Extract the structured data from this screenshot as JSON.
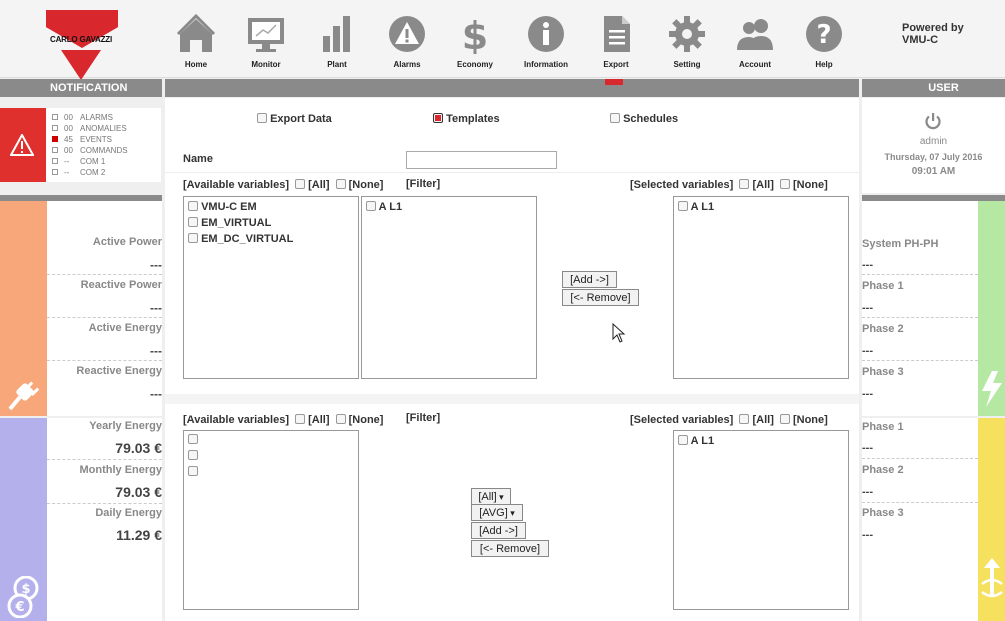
{
  "header": {
    "brand": "CARLO GAVAZZI",
    "nav": [
      {
        "label": "Home",
        "icon": "home-icon"
      },
      {
        "label": "Monitor",
        "icon": "monitor-icon"
      },
      {
        "label": "Plant",
        "icon": "plant-icon"
      },
      {
        "label": "Alarms",
        "icon": "alarms-icon"
      },
      {
        "label": "Economy",
        "icon": "economy-icon"
      },
      {
        "label": "Information",
        "icon": "information-icon"
      },
      {
        "label": "Export",
        "icon": "export-icon"
      },
      {
        "label": "Setting",
        "icon": "setting-icon"
      },
      {
        "label": "Account",
        "icon": "account-icon"
      },
      {
        "label": "Help",
        "icon": "help-icon"
      }
    ],
    "powered_line1": "Powered by",
    "powered_line2": "VMU-C"
  },
  "sections": {
    "notification": "NOTIFICATION",
    "user": "USER"
  },
  "notifications": [
    {
      "count": "00",
      "label": "ALARMS",
      "active": false
    },
    {
      "count": "00",
      "label": "ANOMALIES",
      "active": false
    },
    {
      "count": "45",
      "label": "EVENTS",
      "active": true
    },
    {
      "count": "00",
      "label": "COMMANDS",
      "active": false
    },
    {
      "count": "--",
      "label": "COM 1",
      "active": false
    },
    {
      "count": "--",
      "label": "COM 2",
      "active": false
    }
  ],
  "user": {
    "name": "admin",
    "date": "Thursday, 07 July 2016",
    "time": "09:01 AM"
  },
  "left_power": [
    {
      "label": "Active Power",
      "value": "---"
    },
    {
      "label": "Reactive Power",
      "value": "---"
    },
    {
      "label": "Active Energy",
      "value": "---"
    },
    {
      "label": "Reactive Energy",
      "value": "---"
    }
  ],
  "left_economy": [
    {
      "label": "Yearly Energy",
      "value": "79.03 €"
    },
    {
      "label": "Monthly Energy",
      "value": "79.03 €"
    },
    {
      "label": "Daily Energy",
      "value": "11.29 €"
    }
  ],
  "right_voltage": [
    {
      "label": "System PH-PH",
      "value": "---"
    },
    {
      "label": "Phase 1",
      "value": "---"
    },
    {
      "label": "Phase 2",
      "value": "---"
    },
    {
      "label": "Phase 3",
      "value": "---"
    }
  ],
  "right_current": [
    {
      "label": "Phase 1",
      "value": "---"
    },
    {
      "label": "Phase 2",
      "value": "---"
    },
    {
      "label": "Phase 3",
      "value": "---"
    }
  ],
  "tabs": {
    "export_data": "Export Data",
    "templates": "Templates",
    "schedules": "Schedules"
  },
  "form": {
    "name_label": "Name",
    "name_value": ""
  },
  "selectors": {
    "available": "[Available variables]",
    "all": "[All]",
    "none": "[None]",
    "filter": "[Filter]",
    "selected": "[Selected variables]"
  },
  "top_transfer": {
    "devices": [
      "VMU-C EM",
      "EM_VIRTUAL",
      "EM_DC_VIRTUAL"
    ],
    "variables": [
      "A L1"
    ],
    "selected": [
      "A L1"
    ],
    "add": "[Add ->]",
    "remove": "[<- Remove]"
  },
  "bottom_transfer": {
    "selected": [
      "A L1"
    ],
    "agg_select": "[All]",
    "func_select": "[AVG]",
    "add": "[Add ->]",
    "remove": "[<- Remove]"
  },
  "colors": {
    "brand_red": "#d9272e",
    "power_orange": "#f7a77a",
    "economy_purple": "#b4b0ec",
    "voltage_green": "#b5e8a2",
    "current_yellow": "#f6e15f"
  }
}
